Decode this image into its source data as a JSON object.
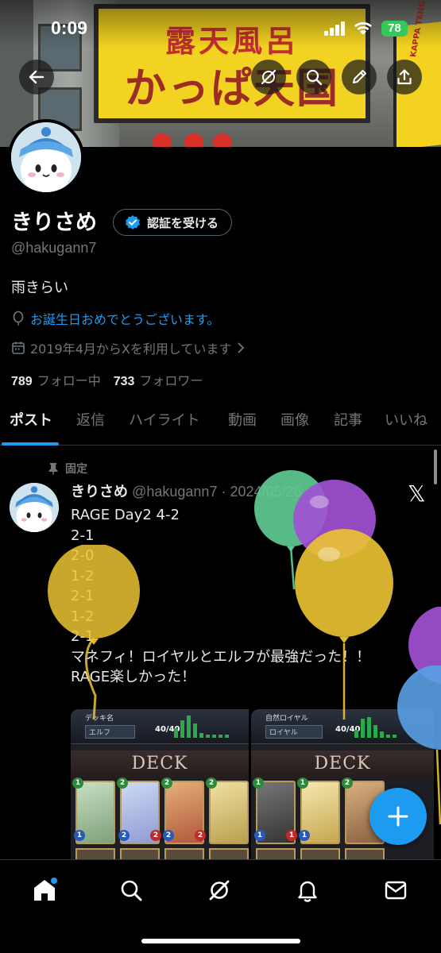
{
  "status_bar": {
    "time": "0:09",
    "battery": "78"
  },
  "banner": {
    "sign_line1": "露天風呂",
    "sign_line2": "かっぱ天国",
    "right_sign": "KAPPA TENGOKU FRONT"
  },
  "header_buttons": [
    "back-icon",
    "grok-icon",
    "search-icon",
    "edit-icon",
    "share-icon"
  ],
  "profile": {
    "name": "きりさめ",
    "verify_label": "認証を受ける",
    "handle": "@hakugann7",
    "bio": "雨きらい",
    "birthday": "お誕生日おめでとうございます。",
    "joined": "2019年4月からXを利用しています",
    "following_count": "789",
    "following_label": "フォロー中",
    "followers_count": "733",
    "followers_label": "フォロワー"
  },
  "tabs": [
    {
      "label": "ポスト",
      "active": true
    },
    {
      "label": "返信"
    },
    {
      "label": "ハイライト"
    },
    {
      "label": "動画"
    },
    {
      "label": "画像"
    },
    {
      "label": "記事"
    },
    {
      "label": "いいね"
    }
  ],
  "post": {
    "pinned_label": "固定",
    "name": "きりさめ",
    "handle_date": "@hakugann7 · 2024/05/26",
    "lines": [
      "RAGE Day2 4-2",
      "2-1",
      "2-0",
      "1-2",
      "2-1",
      "1-2",
      "2-1",
      "マネフィ！ロイヤルとエルフが最強だった！！",
      "RAGE楽しかった！"
    ],
    "decks": [
      {
        "title": "デッキ名",
        "class_name": "エルフ",
        "count": "40/40",
        "banner": "DECK"
      },
      {
        "title": "自然ロイヤル",
        "class_name": "ロイヤル",
        "count": "40/40",
        "banner": "DECK"
      }
    ]
  },
  "colors": {
    "accent": "#1d9bf0",
    "text": "#e7e9ea",
    "muted": "#71767b",
    "background": "#000000"
  },
  "bottom_nav": [
    "home-icon",
    "search-icon",
    "grok-icon",
    "notifications-icon",
    "messages-icon"
  ]
}
